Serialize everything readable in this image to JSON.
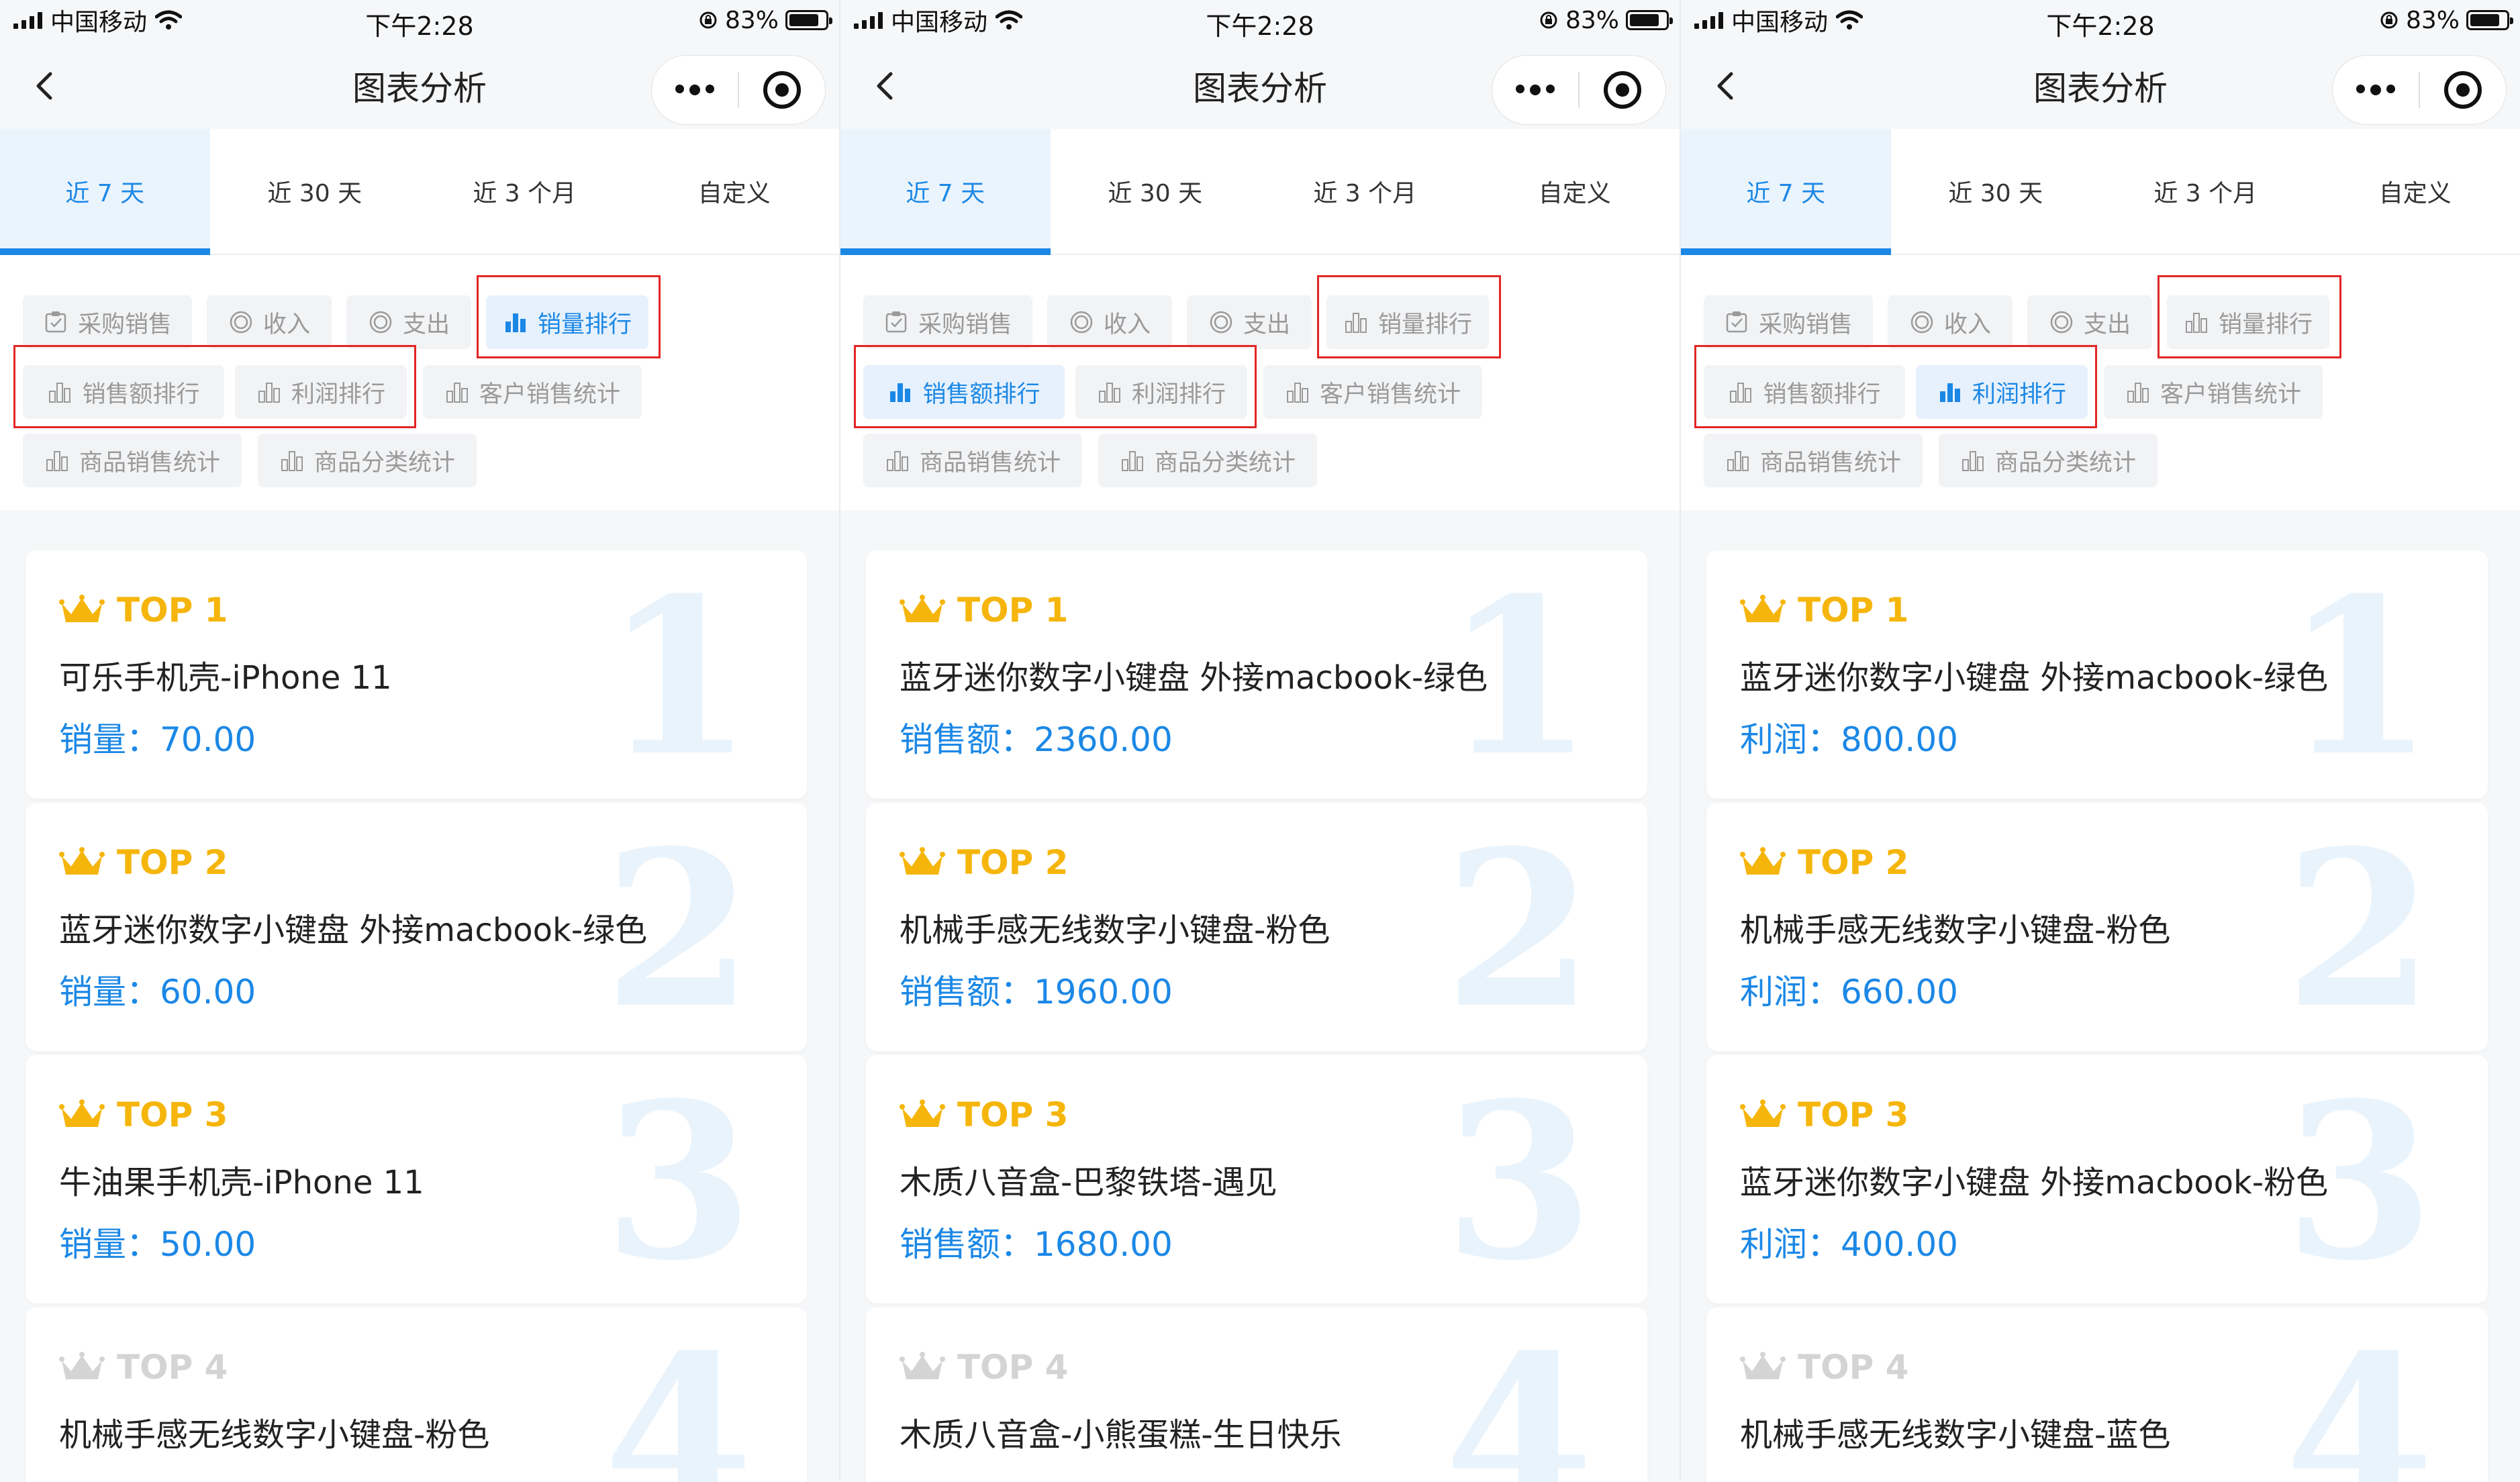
{
  "status": {
    "carrier": "中国移动",
    "time": "下午2:28",
    "battery": "83%",
    "battery_level": 0.83
  },
  "nav": {
    "title": "图表分析"
  },
  "ranges": [
    "近 7 天",
    "近 30 天",
    "近 3 个月",
    "自定义"
  ],
  "chips": {
    "purchase_sales": "采购销售",
    "income": "收入",
    "expense": "支出",
    "sales_volume_rank": "销量排行",
    "sales_amount_rank": "销售额排行",
    "profit_rank": "利润排行",
    "customer_sales_stats": "客户销售统计",
    "product_sales_stats": "商品销售统计",
    "category_sales_stats": "商品分类统计"
  },
  "screens": [
    {
      "active_chip": "sales_volume_rank",
      "items": [
        {
          "rank": "TOP 1",
          "num": "1",
          "name": "可乐手机壳-iPhone 11",
          "metric_label": "销量：",
          "metric_value": "70.00"
        },
        {
          "rank": "TOP 2",
          "num": "2",
          "name": "蓝牙迷你数字小键盘 外接macbook-绿色",
          "metric_label": "销量：",
          "metric_value": "60.00"
        },
        {
          "rank": "TOP 3",
          "num": "3",
          "name": "牛油果手机壳-iPhone 11",
          "metric_label": "销量：",
          "metric_value": "50.00"
        },
        {
          "rank": "TOP 4",
          "num": "4",
          "name": "机械手感无线数字小键盘-粉色"
        }
      ]
    },
    {
      "active_chip": "sales_amount_rank",
      "items": [
        {
          "rank": "TOP 1",
          "num": "1",
          "name": "蓝牙迷你数字小键盘 外接macbook-绿色",
          "metric_label": "销售额：",
          "metric_value": "2360.00"
        },
        {
          "rank": "TOP 2",
          "num": "2",
          "name": "机械手感无线数字小键盘-粉色",
          "metric_label": "销售额：",
          "metric_value": "1960.00"
        },
        {
          "rank": "TOP 3",
          "num": "3",
          "name": "木质八音盒-巴黎铁塔-遇见",
          "metric_label": "销售额：",
          "metric_value": "1680.00"
        },
        {
          "rank": "TOP 4",
          "num": "4",
          "name": "木质八音盒-小熊蛋糕-生日快乐"
        }
      ]
    },
    {
      "active_chip": "profit_rank",
      "items": [
        {
          "rank": "TOP 1",
          "num": "1",
          "name": "蓝牙迷你数字小键盘 外接macbook-绿色",
          "metric_label": "利润：",
          "metric_value": "800.00"
        },
        {
          "rank": "TOP 2",
          "num": "2",
          "name": "机械手感无线数字小键盘-粉色",
          "metric_label": "利润：",
          "metric_value": "660.00"
        },
        {
          "rank": "TOP 3",
          "num": "3",
          "name": "蓝牙迷你数字小键盘 外接macbook-粉色",
          "metric_label": "利润：",
          "metric_value": "400.00"
        },
        {
          "rank": "TOP 4",
          "num": "4",
          "name": "机械手感无线数字小键盘-蓝色"
        }
      ]
    }
  ],
  "colors": {
    "accent": "#1c88e6",
    "gold": "#f5b50a",
    "highlight": "#e32525"
  }
}
